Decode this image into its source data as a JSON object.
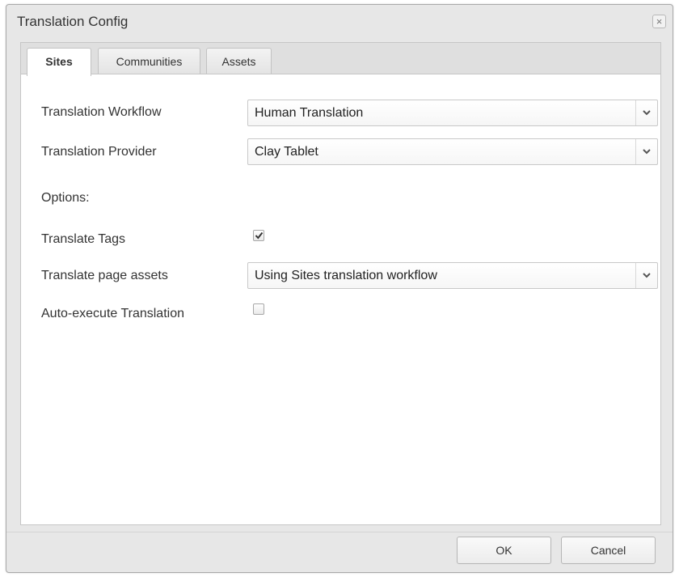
{
  "dialog": {
    "title": "Translation Config",
    "close_symbol": "×"
  },
  "tabs": [
    {
      "label": "Sites",
      "active": true
    },
    {
      "label": "Communities",
      "active": false
    },
    {
      "label": "Assets",
      "active": false
    }
  ],
  "form": {
    "workflow": {
      "label": "Translation Workflow",
      "value": "Human Translation"
    },
    "provider": {
      "label": "Translation Provider",
      "value": "Clay Tablet"
    },
    "options_heading": "Options:",
    "translate_tags": {
      "label": "Translate Tags",
      "checked": true
    },
    "page_assets": {
      "label": "Translate page assets",
      "value": "Using Sites translation workflow"
    },
    "auto_execute": {
      "label": "Auto-execute Translation",
      "checked": false
    }
  },
  "buttons": {
    "ok": "OK",
    "cancel": "Cancel"
  },
  "icons": {
    "close": "close-icon",
    "dropdown": "chevron-down-icon",
    "check": "checkmark-icon"
  },
  "colors": {
    "dialog_bg": "#e7e7e7",
    "panel_bg": "#ffffff",
    "text": "#333333",
    "border": "#c6c6c6"
  }
}
